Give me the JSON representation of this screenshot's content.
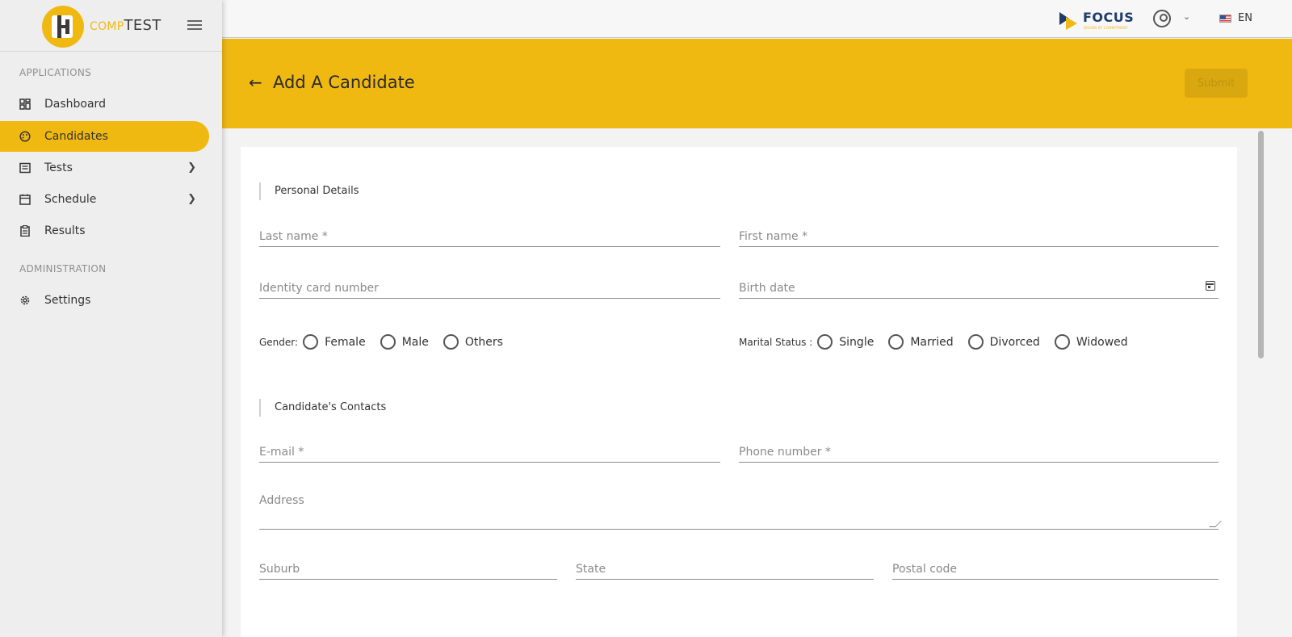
{
  "app": {
    "brand_part1": "COMP",
    "brand_part2": "TEST"
  },
  "sidebar": {
    "section_applications": "APPLICATIONS",
    "section_administration": "ADMINISTRATION",
    "items": [
      {
        "label": "Dashboard",
        "icon": "dashboard-icon"
      },
      {
        "label": "Candidates",
        "icon": "palette-icon",
        "active": true
      },
      {
        "label": "Tests",
        "icon": "list-icon",
        "has_submenu": true
      },
      {
        "label": "Schedule",
        "icon": "calendar-icon",
        "has_submenu": true
      },
      {
        "label": "Results",
        "icon": "clipboard-icon"
      },
      {
        "label": "Settings",
        "icon": "gear-icon"
      }
    ]
  },
  "topbar": {
    "partner_name": "FOCUS",
    "partner_tagline": "DRIVEN BY COMMITMENT",
    "language": "EN"
  },
  "header": {
    "title": "Add A Candidate",
    "submit_label": "Submit"
  },
  "form": {
    "personal_section": "Personal Details",
    "last_name_placeholder": "Last name *",
    "first_name_placeholder": "First name *",
    "id_card_placeholder": "Identity card number",
    "birth_date_placeholder": "Birth date",
    "gender_label": "Gender:",
    "gender_options": [
      "Female",
      "Male",
      "Others"
    ],
    "marital_label": "Marital Status :",
    "marital_options": [
      "Single",
      "Married",
      "Divorced",
      "Widowed"
    ],
    "contacts_section": "Candidate's Contacts",
    "email_placeholder": "E-mail *",
    "phone_placeholder": "Phone number *",
    "address_placeholder": "Address",
    "suburb_placeholder": "Suburb",
    "state_placeholder": "State",
    "postal_placeholder": "Postal code"
  },
  "colors": {
    "accent": "#f0b912",
    "brand_dark": "#1e3c6b"
  }
}
